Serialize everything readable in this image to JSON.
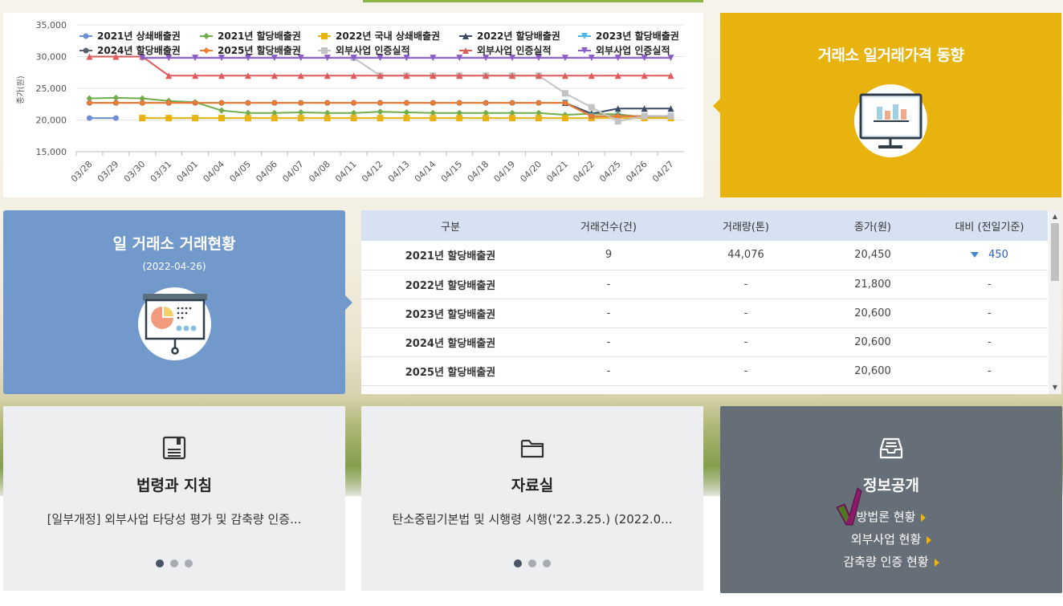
{
  "chart_data": {
    "type": "line",
    "ylabel": "종가(원)",
    "ylim": [
      15000,
      35000
    ],
    "yticks": [
      15000,
      20000,
      25000,
      30000,
      35000
    ],
    "ytick_labels": [
      "15,000",
      "20,000",
      "25,000",
      "30,000",
      "35,000"
    ],
    "categories": [
      "03/28",
      "03/29",
      "03/30",
      "03/31",
      "04/01",
      "04/04",
      "04/05",
      "04/06",
      "04/07",
      "04/08",
      "04/11",
      "04/12",
      "04/13",
      "04/14",
      "04/15",
      "04/18",
      "04/19",
      "04/20",
      "04/21",
      "04/22",
      "04/25",
      "04/26",
      "04/27"
    ],
    "series": [
      {
        "name": "2021년 상쇄배출권",
        "color": "#6d8fd0",
        "marker": "circle",
        "values": [
          20300,
          20300,
          null,
          null,
          null,
          null,
          null,
          null,
          null,
          null,
          null,
          null,
          null,
          null,
          null,
          null,
          null,
          null,
          null,
          null,
          null,
          null,
          null
        ]
      },
      {
        "name": "2021년 할당배출권",
        "color": "#72ad4c",
        "marker": "diamond",
        "values": [
          23400,
          23500,
          23400,
          23000,
          22800,
          21500,
          21100,
          21100,
          21200,
          21100,
          21100,
          21300,
          21200,
          21100,
          21100,
          21100,
          21100,
          21100,
          20800,
          21000,
          20900,
          20450,
          20450
        ]
      },
      {
        "name": "2022년 국내 상쇄배출권",
        "color": "#e8b30f",
        "marker": "square",
        "values": [
          null,
          null,
          20300,
          20300,
          20300,
          20300,
          20300,
          20300,
          20300,
          20300,
          20300,
          20300,
          20300,
          20300,
          20300,
          20300,
          20300,
          20300,
          20300,
          20300,
          20300,
          20300,
          20300
        ]
      },
      {
        "name": "2022년 할당배출권",
        "color": "#3a4a66",
        "marker": "triangle",
        "values": [
          null,
          null,
          null,
          null,
          null,
          null,
          null,
          null,
          null,
          null,
          null,
          null,
          null,
          null,
          null,
          null,
          null,
          null,
          22700,
          21000,
          21800,
          21800,
          21800
        ]
      },
      {
        "name": "2023년 할당배출권",
        "color": "#4ab5ea",
        "marker": "triangle-down",
        "values": [
          null,
          null,
          null,
          null,
          null,
          null,
          null,
          null,
          null,
          null,
          null,
          null,
          null,
          null,
          null,
          null,
          null,
          null,
          22700,
          20600,
          20600,
          20600,
          20600
        ]
      },
      {
        "name": "2024년 할당배출권",
        "color": "#5a6270",
        "marker": "circle",
        "values": [
          22700,
          22700,
          22700,
          22700,
          22700,
          22700,
          22700,
          22700,
          22700,
          22700,
          22700,
          22700,
          22700,
          22700,
          22700,
          22700,
          22700,
          22700,
          22700,
          20600,
          20600,
          20600,
          20600
        ]
      },
      {
        "name": "2025년 할당배출권",
        "color": "#ee7d32",
        "marker": "diamond",
        "values": [
          22700,
          22700,
          22700,
          22700,
          22700,
          22700,
          22700,
          22700,
          22700,
          22700,
          22700,
          22700,
          22700,
          22700,
          22700,
          22700,
          22700,
          22700,
          22700,
          20600,
          20600,
          20600,
          20600
        ]
      },
      {
        "name": "외부사업 인증실적",
        "color": "#c3c3c3",
        "marker": "square",
        "values": [
          null,
          null,
          null,
          null,
          null,
          null,
          null,
          null,
          null,
          null,
          29800,
          27000,
          27000,
          27000,
          27000,
          27000,
          27000,
          27000,
          24200,
          22000,
          19800,
          20600,
          20600
        ]
      },
      {
        "name": "외부사업 인증실적",
        "color": "#e05a5a",
        "marker": "triangle",
        "values": [
          30000,
          30000,
          30000,
          27000,
          27000,
          27000,
          27000,
          27000,
          27000,
          27000,
          27000,
          27000,
          27000,
          27000,
          27000,
          27000,
          27000,
          27000,
          27000,
          27000,
          27000,
          27000,
          27000
        ]
      },
      {
        "name": "외부사업 인증실적",
        "color": "#8a5dc4",
        "marker": "triangle-down",
        "values": [
          null,
          null,
          29800,
          29800,
          29800,
          29800,
          29800,
          29800,
          29800,
          29800,
          29800,
          29800,
          29800,
          29800,
          29800,
          29800,
          29800,
          29800,
          29800,
          29800,
          29800,
          29800,
          29800
        ]
      }
    ],
    "grid": true,
    "legend_position": "top"
  },
  "trend": {
    "title": "거래소 일거래가격 동향"
  },
  "market": {
    "title": "일 거래소 거래현황",
    "date": "(2022-04-26)",
    "headers": [
      "구분",
      "거래건수(건)",
      "거래량(톤)",
      "종가(원)",
      "대비 (전일기준)"
    ],
    "rows": [
      {
        "name": "2021년 할당배출권",
        "count": "9",
        "volume": "44,076",
        "close": "20,450",
        "diff": "450",
        "diff_dir": "down"
      },
      {
        "name": "2022년 할당배출권",
        "count": "-",
        "volume": "-",
        "close": "21,800",
        "diff": "-",
        "diff_dir": ""
      },
      {
        "name": "2023년 할당배출권",
        "count": "-",
        "volume": "-",
        "close": "20,600",
        "diff": "-",
        "diff_dir": ""
      },
      {
        "name": "2024년 할당배출권",
        "count": "-",
        "volume": "-",
        "close": "20,600",
        "diff": "-",
        "diff_dir": ""
      },
      {
        "name": "2025년 할당배출권",
        "count": "-",
        "volume": "-",
        "close": "20,600",
        "diff": "-",
        "diff_dir": ""
      }
    ]
  },
  "law": {
    "title": "법령과 지침",
    "text": "[일부개정] 외부사업 타당성 평가 및 감축량 인증...",
    "icon": "book-save-icon"
  },
  "archive": {
    "title": "자료실",
    "text": "탄소중립기본법 및 시행령 시행('22.3.25.) (2022.0...",
    "icon": "folder-icon"
  },
  "disclosure": {
    "title": "정보공개",
    "icon": "inbox-tray-icon",
    "links": [
      "방법론 현황",
      "외부사업 현황",
      "감축량 인증 현황"
    ]
  },
  "colors": {
    "accent_yellow": "#e8b30f",
    "accent_blue": "#7299cb",
    "dark_card": "#666e78"
  }
}
